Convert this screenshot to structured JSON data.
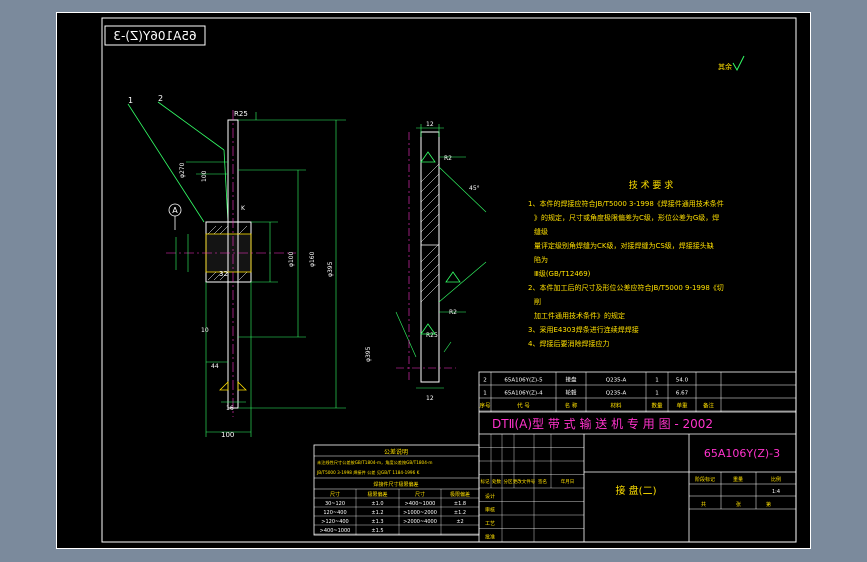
{
  "colors": {
    "background": "#000000",
    "frame": "#ffffff",
    "magenta": "#ff33cc",
    "cyan": "#33e0ff",
    "yellow": "#ffe000",
    "green": "#33ff66",
    "hatch": "#ffffff"
  },
  "drawing": {
    "mirrored_code": "65A106Y(Z)-3",
    "roughness_note": "其余",
    "part_labels": [
      "1",
      "2"
    ],
    "datum_label": "A",
    "dimensions": {
      "top_radius": "R25",
      "r12": "12",
      "phi270": "φ270",
      "d100": "100",
      "phi100": "φ100",
      "phi160": "φ160",
      "phi395": "φ395",
      "d32": "32",
      "d10": "10",
      "d44": "44",
      "d16": "16",
      "bottom_100": "100",
      "right_12_top": "12",
      "right_12_bottom": "12",
      "r2_top": "R2",
      "r2_bottom": "R2",
      "r25": "R25",
      "phi_right": "φ395",
      "angle_45": "45°",
      "k_mark": "K"
    }
  },
  "tech_requirements": {
    "title": "技 术 要 求",
    "lines": [
      "1、本件的焊接应符合JB/T5000 3-1998《焊接件通用技术条件",
      "》的规定，尺寸或角度极限偏差为C级，形位公差为G级，焊",
      "缝级",
      "量评定级别角焊缝为CK级，对接焊缝为CS级，焊接接头缺",
      "陷为",
      "Ⅲ级(GB/T12469)",
      "2、本件加工后的尺寸及形位公差应符合JB/T5000 9-1998《切",
      "削",
      "加工件通用技术条件》的规定",
      "3、采用E4303焊条进行连续焊焊接",
      "4、焊接后要消除焊接应力"
    ]
  },
  "tolerance_table": {
    "title": "公差说明",
    "notes": [
      "未注线性尺寸公差按GB/T1804-m，角度公差按GB/T1804-m",
      "JB/T5000 3-1998 焊接件 公差 见GB/T 1184-1996 K"
    ],
    "subtitle": "焊接件尺寸极限偏差",
    "headers": [
      "尺寸",
      "极限偏差",
      "尺寸",
      "极限偏差"
    ],
    "rows": [
      [
        "30~120",
        "±1.0",
        ">400~1000",
        "±1.8"
      ],
      [
        "120~400",
        "±1.2",
        ">1000~2000",
        "±1.2"
      ],
      [
        ">120~400",
        "±1.3",
        ">2000~4000",
        "±2"
      ],
      [
        ">400~1000",
        "±1.5",
        "",
        ""
      ]
    ]
  },
  "title_block": {
    "project_title": "DTⅡ(A)型  带 式 输 送 机 专 用 图 - 2002",
    "drawing_code": "65A106Y(Z)-3",
    "part_name": "接 盘(二)",
    "scale_label": "比例",
    "scale_value": "1:4",
    "sheet_label": "第",
    "sheet_total_label": "共",
    "sheet_page_label": "张",
    "material_label": "材料",
    "weight_label": "重量",
    "parts_rows": [
      [
        "2",
        "65A106Y(Z)-5",
        "接盘",
        "Q235-A",
        "1",
        "54.0",
        ""
      ],
      [
        "1",
        "65A106Y(Z)-4",
        "轮毂",
        "Q235-A",
        "1",
        "6.67",
        ""
      ],
      [
        "序号",
        "代 号",
        "名 称",
        "材料",
        "数量",
        "单重",
        "备注"
      ]
    ],
    "sign_labels": [
      "标记",
      "处数",
      "分区",
      "更改文件号",
      "签名",
      "年月日"
    ],
    "design_labels": [
      "设计",
      "审核",
      "工艺",
      "批准"
    ],
    "stage_labels": [
      "阶段标记",
      "重量",
      "比例"
    ]
  }
}
